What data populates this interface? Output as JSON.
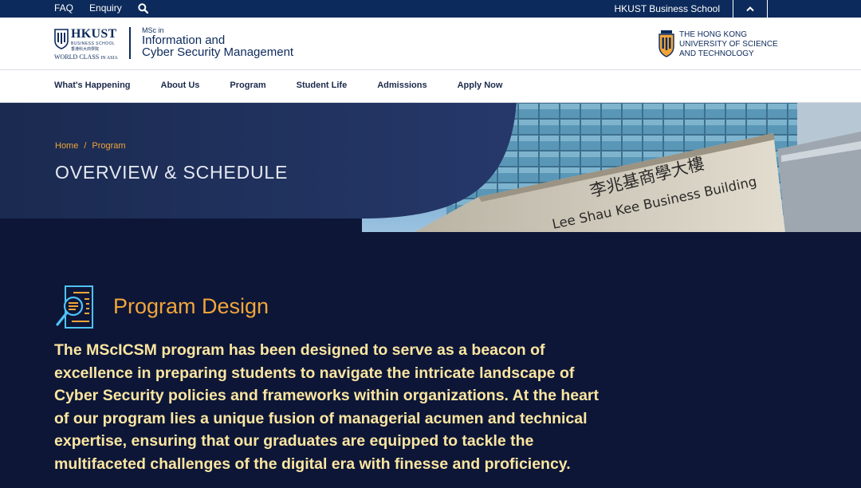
{
  "topbar": {
    "faq": "FAQ",
    "enquiry": "Enquiry",
    "school": "HKUST Business School"
  },
  "header": {
    "hk_logo": {
      "word": "HKUST",
      "sub": "BUSINESS SCHOOL",
      "cn": "香港科大商學院",
      "tag_main": "WORLD CLASS",
      "tag_small": "IN ASIA"
    },
    "program": {
      "prefix": "MSc in",
      "line1": "Information and",
      "line2": "Cyber Security Management"
    },
    "ust_logo": {
      "line1": "THE HONG KONG",
      "line2": "UNIVERSITY OF SCIENCE",
      "line3": "AND TECHNOLOGY"
    }
  },
  "nav": {
    "items": [
      {
        "label": "What's Happening"
      },
      {
        "label": "About Us"
      },
      {
        "label": "Program"
      },
      {
        "label": "Student Life"
      },
      {
        "label": "Admissions"
      },
      {
        "label": "Apply Now"
      }
    ]
  },
  "hero": {
    "breadcrumb": {
      "home": "Home",
      "separator": "/",
      "current": "Program"
    },
    "title": "OVERVIEW & SCHEDULE",
    "building_cn": "李兆基商學大樓",
    "building_en": "Lee Shau Kee Business Building"
  },
  "content": {
    "title": "Program Design",
    "body": "The MScICSM program has been designed to serve as a beacon of excellence in preparing students to navigate the intricate landscape of Cyber Security policies and frameworks within organizations. At the heart of our program lies a unique fusion of managerial acumen and technical expertise, ensuring that our graduates are equipped to tackle the multifaceted challenges of the digital era with finesse and proficiency."
  },
  "colors": {
    "navy": "#0c2a5b",
    "dark_bg": "#0d1637",
    "accent": "#f1a53a",
    "body_text": "#fbe6a1"
  }
}
